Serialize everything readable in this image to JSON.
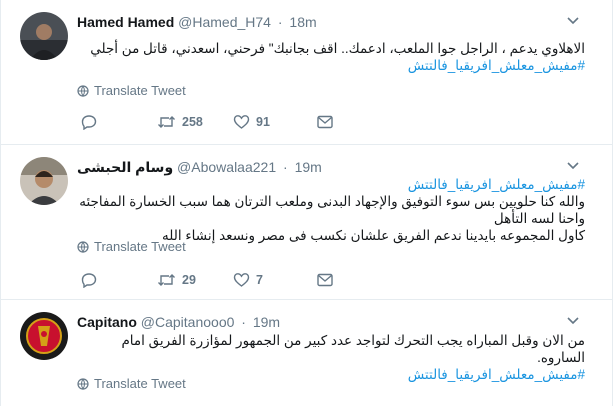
{
  "colors": {
    "link": "#1b95e0",
    "secondary": "#657786",
    "border": "#e6ecf0",
    "text": "#14171a"
  },
  "tweets": [
    {
      "name": "Hamed Hamed",
      "handle": "@Hamed_H74",
      "dot": "·",
      "time": "18m",
      "lines": [
        "الاهلاوي يدعم ، الراجل جوا الملعب، ادعمك.. اقف بجانبك\" فرحني، اسعدني، قاتل من أجلي"
      ],
      "hashtags": [
        "#مفيش_معلش_افريقيا_فالتتش"
      ],
      "translate": "Translate Tweet",
      "retweets": "258",
      "likes": "91"
    },
    {
      "name": "وسام الحبشى",
      "handle": "@Abowalaa221",
      "dot": "·",
      "time": "19m",
      "hashtag_top": "#مفيش_معلش_افريقيا_فالتتش",
      "lines": [
        "والله كنا حلويين بس سوء التوفيق والإجهاد البدنى وملعب الترتان هما سبب الخسارة المفاجئه واحنا لسه التأهل",
        "كاول المجموعه بايدينا ندعم الفريق علشان نكسب فى مصر ونسعد إنشاء الله"
      ],
      "translate": "Translate Tweet",
      "retweets": "29",
      "likes": "7"
    },
    {
      "name": "Capitano",
      "handle": "@Capitanooo0",
      "dot": "·",
      "time": "19m",
      "lines": [
        "من الان وقبل المباراه يجب التحرك لتواجد عدد كبير من الجمهور لمؤازرة الفريق امام الساروه."
      ],
      "hashtags": [
        "#مفيش_معلش_افريقيا_فالتتش"
      ],
      "translate": "Translate Tweet"
    }
  ]
}
